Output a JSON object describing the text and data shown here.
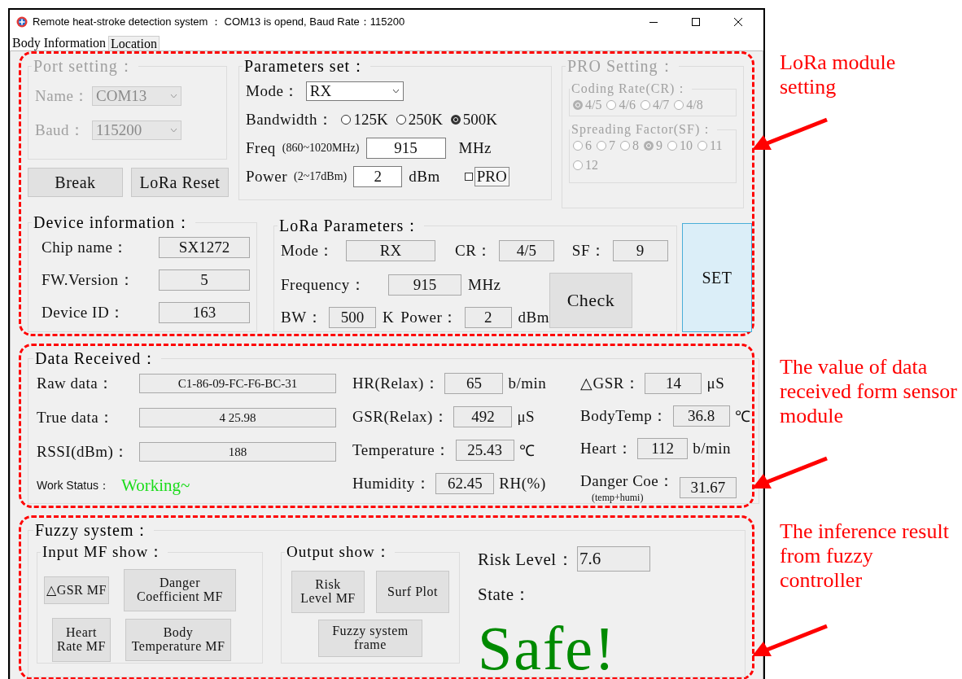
{
  "window": {
    "title": "Remote heat-stroke detection system ： COM13 is opend, Baud Rate：115200"
  },
  "tabs": [
    {
      "label": "Body Information",
      "selected": true
    },
    {
      "label": "Location",
      "selected": false
    }
  ],
  "port_setting": {
    "title": "Port setting：",
    "disabled": true,
    "fields": [
      {
        "label": "Name：",
        "value": "COM13"
      },
      {
        "label": "Baud：",
        "value": "115200"
      }
    ]
  },
  "port_buttons": [
    "Break",
    "LoRa Reset"
  ],
  "parameters_set": {
    "title": "Parameters set：",
    "mode": {
      "label": "Mode：",
      "value": "RX"
    },
    "bandwidth": {
      "label": "Bandwidth：",
      "options": [
        {
          "label": "125K",
          "selected": false
        },
        {
          "label": "250K",
          "selected": false
        },
        {
          "label": "500K",
          "selected": true
        }
      ]
    },
    "freq": {
      "label": "Freq",
      "hint": "(860~1020MHz)",
      "value": "915",
      "unit": "MHz"
    },
    "power": {
      "label": "Power",
      "hint": "(2~17dBm)",
      "value": "2",
      "unit": "dBm"
    },
    "pro": {
      "label": "PRO",
      "checked": false
    }
  },
  "pro_setting": {
    "title": "PRO Setting：",
    "disabled": true,
    "groups": [
      {
        "title": "Coding Rate(CR)：",
        "options": [
          {
            "label": "4/5",
            "selected": true
          },
          {
            "label": "4/6",
            "selected": false
          },
          {
            "label": "4/7",
            "selected": false
          },
          {
            "label": "4/8",
            "selected": false
          }
        ]
      },
      {
        "title": "Spreading Factor(SF)：",
        "options": [
          {
            "label": "6",
            "selected": false
          },
          {
            "label": "7",
            "selected": false
          },
          {
            "label": "8",
            "selected": false
          },
          {
            "label": "9",
            "selected": true
          },
          {
            "label": "10",
            "selected": false
          },
          {
            "label": "11",
            "selected": false
          },
          {
            "label": "12",
            "selected": false
          }
        ]
      }
    ]
  },
  "device_information": {
    "title": "Device information：",
    "rows": [
      {
        "label": "Chip name：",
        "value": "SX1272"
      },
      {
        "label": "FW.Version：",
        "value": "5"
      },
      {
        "label": "Device ID：",
        "value": "163"
      }
    ]
  },
  "lora_parameters": {
    "title": "LoRa Parameters：",
    "rows": [
      [
        {
          "label": "Mode：",
          "value": "RX"
        },
        {
          "label": "CR：",
          "value": "4/5"
        },
        {
          "label": "SF：",
          "value": "9"
        }
      ],
      [
        {
          "label": "Frequency：",
          "value": "915",
          "unit": "MHz"
        }
      ],
      [
        {
          "label": "BW：",
          "value": "500",
          "unit": "K"
        },
        {
          "label": "Power：",
          "value": "2",
          "unit": "dBm"
        }
      ]
    ],
    "check_button": "Check"
  },
  "set_button": "SET",
  "data_received": {
    "title": "Data Received：",
    "column_1": [
      {
        "label": "Raw data：",
        "value": "C1-86-09-FC-F6-BC-31"
      },
      {
        "label": "True data：",
        "value": "4 25.98"
      },
      {
        "label": "RSSI(dBm)：",
        "value": "188"
      }
    ],
    "work_status": {
      "label": "Work Status：",
      "value": "Working~"
    },
    "column_2": [
      {
        "label": "HR(Relax)：",
        "value": "65",
        "unit": "b/min"
      },
      {
        "label": "GSR(Relax)：",
        "value": "492",
        "unit": "μS"
      },
      {
        "label": "Temperature：",
        "value": "25.43",
        "unit": "℃"
      },
      {
        "label": "Humidity：",
        "value": "62.45",
        "unit": "RH(%)"
      }
    ],
    "column_3": [
      {
        "label": "△GSR：",
        "value": "14",
        "unit": "μS"
      },
      {
        "label": "BodyTemp：",
        "value": "36.8",
        "unit": "℃"
      },
      {
        "label": "Heart：",
        "value": "112",
        "unit": "b/min"
      },
      {
        "label": "Danger Coe：",
        "note": "(temp+humi)",
        "value": "31.67"
      }
    ]
  },
  "fuzzy_system": {
    "title": "Fuzzy system：",
    "input_mf": {
      "title": "Input MF show：",
      "buttons": [
        "△GSR MF",
        "Danger\nCoefficient MF",
        "Heart\nRate MF",
        "Body\nTemperature MF"
      ]
    },
    "output": {
      "title": "Output show：",
      "buttons": [
        "Risk\nLevel MF",
        "Surf Plot",
        "Fuzzy system\nframe"
      ]
    },
    "risk_level": {
      "label": "Risk Level：",
      "value": "7.6"
    },
    "state": {
      "label": "State：",
      "value": "Safe!"
    }
  },
  "annotations": [
    "LoRa module setting",
    "The value of data received form sensor module",
    "The inference result from fuzzy controller"
  ]
}
